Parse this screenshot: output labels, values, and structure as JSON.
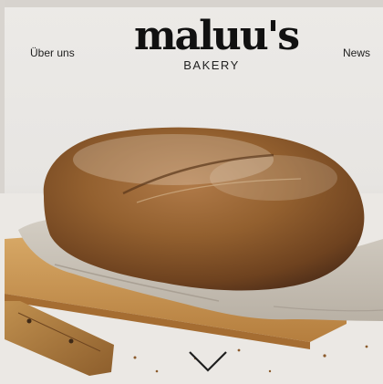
{
  "nav": {
    "left_link": "Über uns",
    "right_link": "News"
  },
  "brand": {
    "name": "maluu's",
    "tagline": "BAKERY"
  },
  "hero": {
    "image": "bread-loaf-on-linen-and-cutting-board",
    "scroll_icon": "chevron-down-icon"
  },
  "colors": {
    "background": "#e8e6e3",
    "text": "#111111",
    "crust": "#8a5a32",
    "linen": "#c9c2b6",
    "board": "#c9944f"
  }
}
